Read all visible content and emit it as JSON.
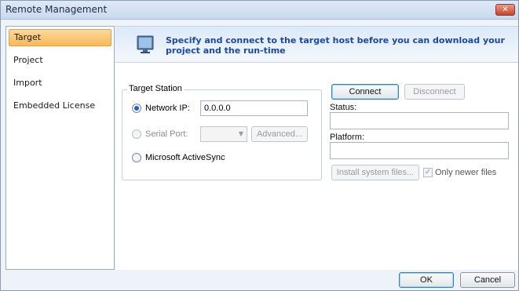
{
  "window": {
    "title": "Remote Management",
    "close_label": "✕"
  },
  "sidebar": {
    "items": [
      {
        "label": "Target",
        "active": true
      },
      {
        "label": "Project",
        "active": false
      },
      {
        "label": "Import",
        "active": false
      },
      {
        "label": "Embedded License",
        "active": false
      }
    ]
  },
  "banner": {
    "text": "Specify and connect to the target host before you can download your project and the run-time",
    "icon": "monitor-icon"
  },
  "target_station": {
    "group_label": "Target Station",
    "network_ip_label": "Network IP:",
    "network_ip_value": "0.0.0.0",
    "serial_port_label": "Serial Port:",
    "serial_port_value": "",
    "advanced_label": "Advanced...",
    "activesync_label": "Microsoft ActiveSync",
    "selected": "network_ip"
  },
  "connection": {
    "connect_label": "Connect",
    "disconnect_label": "Disconnect",
    "status_label": "Status:",
    "status_value": "",
    "platform_label": "Platform:",
    "platform_value": "",
    "install_label": "Install system files...",
    "only_newer_label": "Only newer files",
    "only_newer_checked": true
  },
  "footer": {
    "ok_label": "OK",
    "cancel_label": "Cancel"
  },
  "colors": {
    "accent_selected": "#f6b85a",
    "banner_text": "#1b4aa0",
    "window_bg": "#eef3fa"
  }
}
